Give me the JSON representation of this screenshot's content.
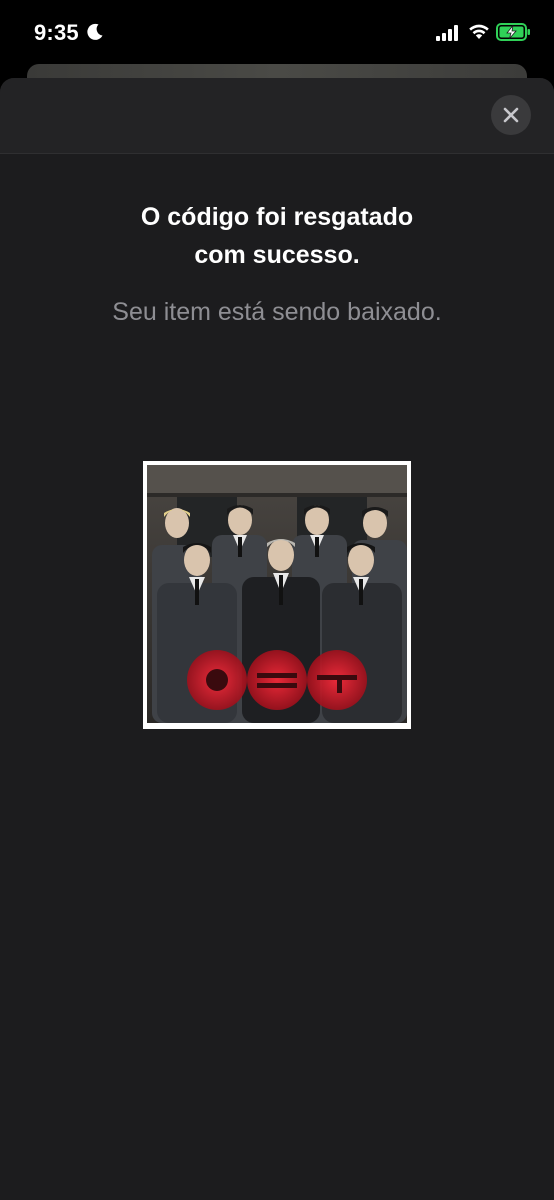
{
  "status_bar": {
    "time": "9:35",
    "icons": [
      "moon-icon",
      "signal-icon",
      "wifi-icon",
      "battery-charging-icon"
    ],
    "battery_color": "#30d158"
  },
  "sheet": {
    "close_icon": "close-icon",
    "title_line1": "O código foi resgatado",
    "title_line2": "com sucesso.",
    "subtitle": "Seu item está sendo baixado.",
    "album_art": "album-cover-image"
  },
  "colors": {
    "background": "#000000",
    "sheet": "#1c1c1e",
    "title": "#ffffff",
    "subtitle": "#8e8e93",
    "close_button": "#3a3a3c"
  }
}
